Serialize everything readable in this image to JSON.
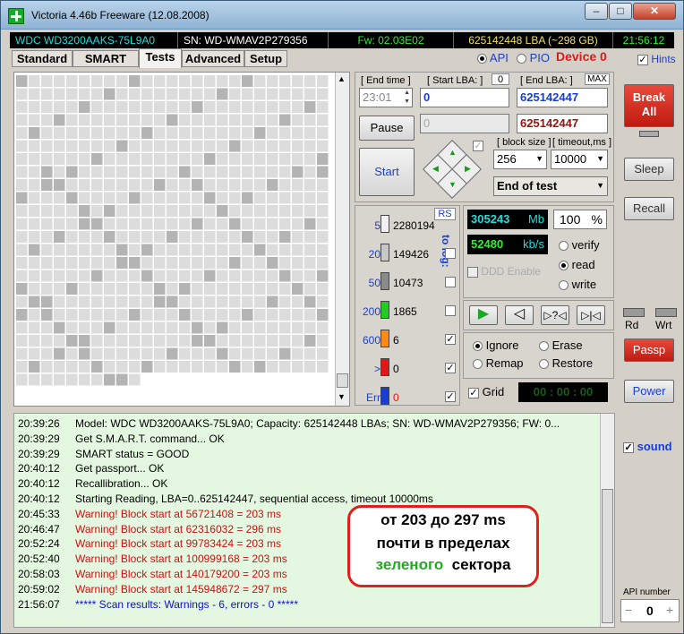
{
  "window": {
    "title": "Victoria 4.46b Freeware (12.08.2008)"
  },
  "infobar": {
    "model": "WDC WD3200AAKS-75L9A0",
    "serial": "SN: WD-WMAV2P279356",
    "firmware": "Fw: 02.03E02",
    "lba": "625142448 LBA (~298 GB)",
    "clock": "21:56:12"
  },
  "tabs": [
    "Standard",
    "SMART",
    "Tests",
    "Advanced",
    "Setup"
  ],
  "mode": {
    "api": "API",
    "pio": "PIO",
    "device": "Device 0",
    "hints": "Hints"
  },
  "controls": {
    "end_time_label": "[ End time ]",
    "end_time_value": "23:01",
    "start_lba_label": "[ Start LBA: ]",
    "start_lba_zero": "0",
    "start_lba_value": "0",
    "end_lba_label": "[ End LBA: ]",
    "max_label": "MAX",
    "end_lba_value": "625142447",
    "current_lba_value": "625142447",
    "current_start_value": "0",
    "pause": "Pause",
    "start": "Start",
    "block_size_label": "[ block size ]",
    "block_size_value": "256",
    "timeout_label": "[ timeout,ms ]",
    "timeout_value": "10000",
    "end_of_test": "End of test"
  },
  "stats": {
    "rs": "RS",
    "to_log": "to log:",
    "rows": [
      {
        "label": "5",
        "count": "2280194",
        "color": "#f2f2f2",
        "checked": false
      },
      {
        "label": "20",
        "count": "149426",
        "color": "#c8c8c8",
        "checked": false
      },
      {
        "label": "50",
        "count": "10473",
        "color": "#8a8a8a",
        "checked": false
      },
      {
        "label": "200",
        "count": "1865",
        "color": "#22cc22",
        "checked": false
      },
      {
        "label": "600",
        "count": "6",
        "color": "#ff8a1a",
        "checked": true
      },
      {
        "label": ">",
        "count": "0",
        "color": "#e01818",
        "checked": true
      },
      {
        "label": "Err",
        "count": "0",
        "color": "#1a3fd0",
        "checked": true
      }
    ]
  },
  "speed": {
    "mb_value": "305243",
    "mb_unit": "Mb",
    "percent": "100",
    "percent_unit": "%",
    "kbs_value": "52480",
    "kbs_unit": "kb/s",
    "ddd_enable": "DDD Enable",
    "verify": "verify",
    "read": "read",
    "write": "write"
  },
  "actions": {
    "ignore": "Ignore",
    "erase": "Erase",
    "remap": "Remap",
    "restore": "Restore",
    "grid": "Grid",
    "timer": "00 : 00 : 00"
  },
  "rightcol": {
    "break_all": "Break\nAll",
    "sleep": "Sleep",
    "recall": "Recall",
    "rd": "Rd",
    "wrt": "Wrt",
    "passp": "Passp",
    "power": "Power",
    "sound": "sound",
    "api_number_label": "API number",
    "api_number_value": "0"
  },
  "log": [
    {
      "time": "20:39:26",
      "msg": "Model: WDC WD3200AAKS-75L9A0; Capacity: 625142448 LBAs; SN: WD-WMAV2P279356; FW: 0...",
      "color": "#000000"
    },
    {
      "time": "20:39:29",
      "msg": "Get S.M.A.R.T. command... OK",
      "color": "#000000"
    },
    {
      "time": "20:39:29",
      "msg": "SMART status = GOOD",
      "color": "#000000"
    },
    {
      "time": "20:40:12",
      "msg": "Get passport... OK",
      "color": "#000000"
    },
    {
      "time": "20:40:12",
      "msg": "Recallibration... OK",
      "color": "#000000"
    },
    {
      "time": "20:40:12",
      "msg": "Starting Reading, LBA=0..625142447, sequential access, timeout 10000ms",
      "color": "#000000"
    },
    {
      "time": "20:45:33",
      "msg": "Warning! Block start at 56721408 = 203 ms",
      "color": "#d01010"
    },
    {
      "time": "20:46:47",
      "msg": "Warning! Block start at 62316032 = 296 ms",
      "color": "#d01010"
    },
    {
      "time": "20:52:24",
      "msg": "Warning! Block start at 99783424 = 203 ms",
      "color": "#d01010"
    },
    {
      "time": "20:52:40",
      "msg": "Warning! Block start at 100999168 = 203 ms",
      "color": "#d01010"
    },
    {
      "time": "20:58:03",
      "msg": "Warning! Block start at 140179200 = 203 ms",
      "color": "#d01010"
    },
    {
      "time": "20:59:02",
      "msg": "Warning! Block start at 145948672 = 297 ms",
      "color": "#d01010"
    },
    {
      "time": "21:56:07",
      "msg": "***** Scan results: Warnings - 6, errors - 0 *****",
      "color": "#1010c0"
    }
  ],
  "callout": {
    "line1": "от 203 до 297 ms",
    "line2": "почти в пределах",
    "line3a": "зеленого",
    "line3b": "сектора"
  },
  "colors": {
    "green_accent": "#22aa22",
    "red_accent": "#e0201a",
    "cyan_text": "#22dddd"
  }
}
